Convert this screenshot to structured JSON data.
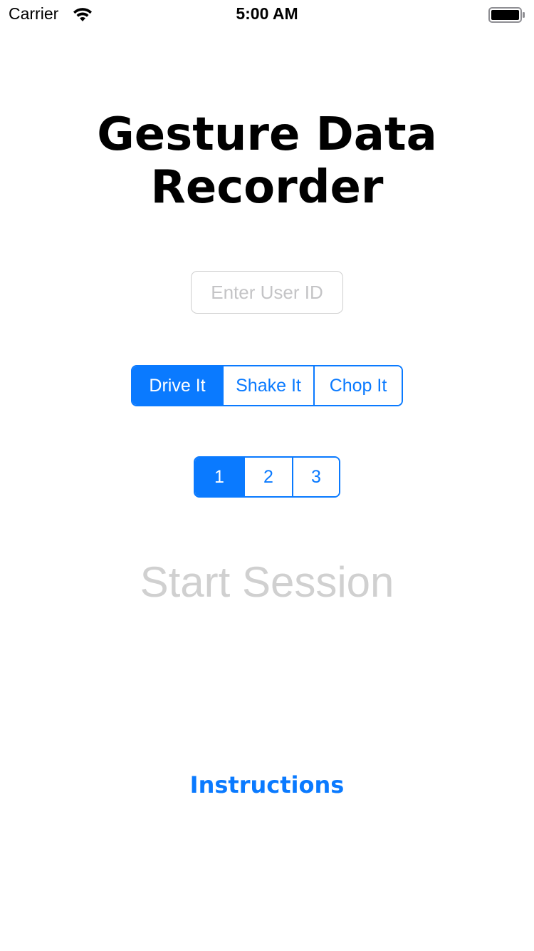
{
  "status_bar": {
    "carrier": "Carrier",
    "time": "5:00 AM",
    "wifi_icon": "wifi-icon",
    "battery_icon": "battery-icon"
  },
  "title": {
    "line1": "Gesture Data",
    "line2": "Recorder"
  },
  "user_id": {
    "value": "",
    "placeholder": "Enter User ID"
  },
  "gesture_selector": {
    "options": [
      "Drive It",
      "Shake It",
      "Chop It"
    ],
    "selected": "Drive It"
  },
  "session_selector": {
    "options": [
      "1",
      "2",
      "3"
    ],
    "selected": "1"
  },
  "start_session_label": "Start Session",
  "instructions_label": "Instructions",
  "colors": {
    "accent": "#0a7aff",
    "disabled_text": "#d0d0d0",
    "placeholder": "#c4c4c6"
  }
}
